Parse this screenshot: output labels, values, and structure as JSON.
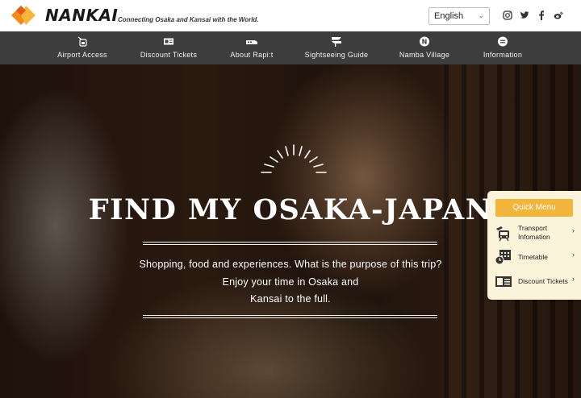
{
  "header": {
    "brand": "NANKAI",
    "tagline": "Connecting Osaka and Kansai with the World.",
    "language": {
      "selected": "English"
    },
    "social": [
      "instagram-icon",
      "twitter-icon",
      "facebook-icon",
      "weibo-icon"
    ]
  },
  "nav": {
    "items": [
      {
        "label": "Airport Access",
        "icon": "airport-icon"
      },
      {
        "label": "Discount Tickets",
        "icon": "ticket-icon"
      },
      {
        "label": "About Rapi:t",
        "icon": "train-icon"
      },
      {
        "label": "Sightseeing Guide",
        "icon": "guide-icon"
      },
      {
        "label": "Namba Village",
        "icon": "namba-icon",
        "glyph": "N"
      },
      {
        "label": "Information",
        "icon": "info-icon"
      }
    ]
  },
  "hero": {
    "title": "FIND MY OSAKA-JAPAN",
    "line1": "Shopping, food and experiences. What is the purpose of this trip?",
    "line2": "Enjoy your time in Osaka and",
    "line3": "Kansai to the full."
  },
  "quick_menu": {
    "title": "Quick Menu",
    "items": [
      {
        "label": "Transport Infomation",
        "icon": "transport-icon"
      },
      {
        "label": "Timetable",
        "icon": "timetable-icon"
      },
      {
        "label": "Discount Tickets",
        "icon": "ticket-icon"
      }
    ]
  },
  "colors": {
    "nav_bg": "#3d3d3d",
    "accent": "#f2b53b",
    "brand_orange": "#f08a1c",
    "quick_menu_bg": "#fbf3da"
  }
}
